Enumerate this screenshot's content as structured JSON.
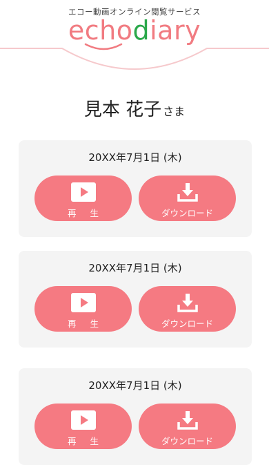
{
  "header": {
    "tagline": "エコー動画オンライン閲覧サービス",
    "logo_part1": "echo",
    "logo_part2": "d",
    "logo_part3": "iary"
  },
  "user": {
    "name": "見本 花子",
    "honorific": "さま"
  },
  "colors": {
    "accent": "#f57a82",
    "logo_pink": "#f17b81",
    "logo_green": "#2aa84a",
    "card_bg": "#f4f4f4"
  },
  "records": [
    {
      "date": "20XX年7月1日 (木)",
      "play_label": "再 生",
      "download_label": "ダウンロード",
      "play_icon": "play-icon",
      "download_icon": "download-icon"
    },
    {
      "date": "20XX年7月1日 (木)",
      "play_label": "再 生",
      "download_label": "ダウンロード",
      "play_icon": "play-icon",
      "download_icon": "download-icon"
    },
    {
      "date": "20XX年7月1日 (木)",
      "play_label": "再 生",
      "download_label": "ダウンロード",
      "play_icon": "play-icon",
      "download_icon": "download-icon"
    }
  ]
}
